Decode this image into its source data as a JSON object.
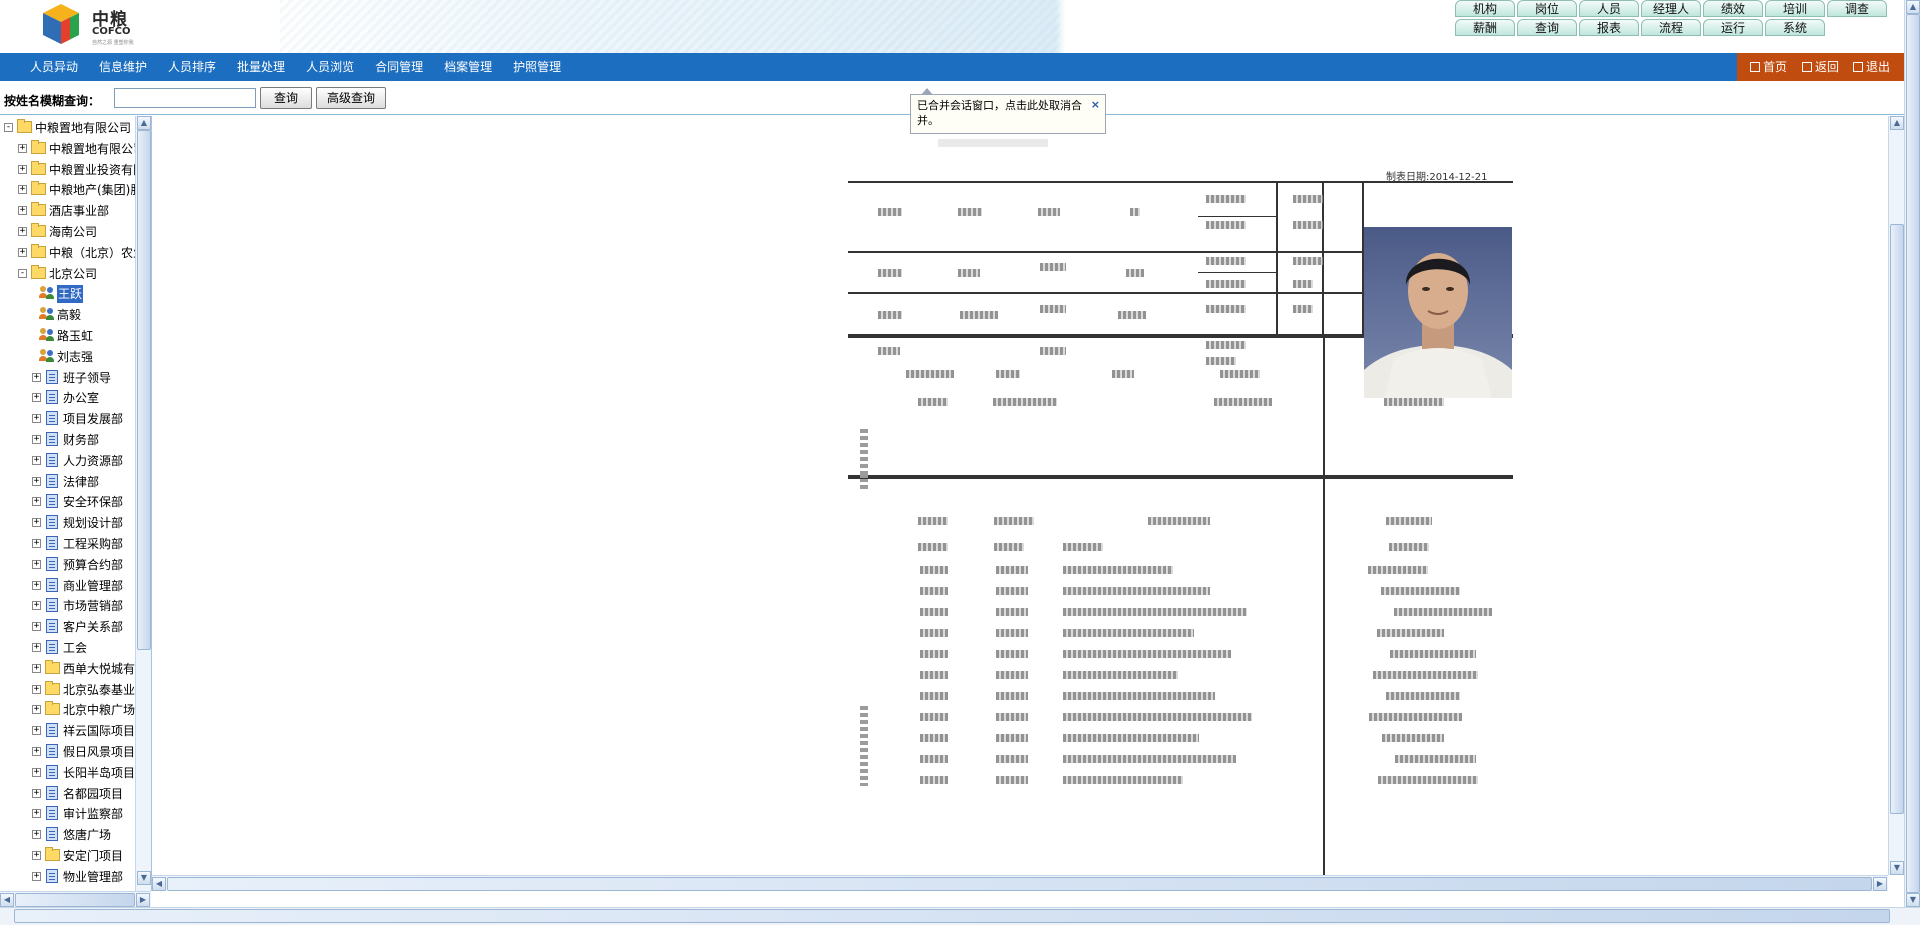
{
  "header": {
    "logo": {
      "brand_cn": "中粮",
      "brand_en": "COFCO",
      "slogan": "自然之源 重塑你我"
    },
    "top_nav_row1": [
      "机构",
      "岗位",
      "人员",
      "经理人",
      "绩效",
      "培训",
      "调查"
    ],
    "top_nav_row2": [
      "薪酬",
      "查询",
      "报表",
      "流程",
      "运行",
      "系统"
    ]
  },
  "navbar": {
    "menu": [
      "人员异动",
      "信息维护",
      "人员排序",
      "批量处理",
      "人员浏览",
      "合同管理",
      "档案管理",
      "护照管理"
    ],
    "home": "首页",
    "back": "返回",
    "logout": "退出"
  },
  "search": {
    "label": "按姓名模糊查询：",
    "input_value": "",
    "query_btn": "查询",
    "advanced_btn": "高级查询"
  },
  "tree": [
    {
      "label": "中粮置地有限公司",
      "level": 0,
      "icon": "folder-icon",
      "toggle": "−"
    },
    {
      "label": "中粮置地有限公司",
      "level": 1,
      "icon": "folder-icon",
      "toggle": "+"
    },
    {
      "label": "中粮置业投资有限",
      "level": 1,
      "icon": "folder-icon",
      "toggle": "+"
    },
    {
      "label": "中粮地产(集团)股",
      "level": 1,
      "icon": "folder-icon",
      "toggle": "+"
    },
    {
      "label": "酒店事业部",
      "level": 1,
      "icon": "folder-icon",
      "toggle": "+"
    },
    {
      "label": "海南公司",
      "level": 1,
      "icon": "folder-icon",
      "toggle": "+"
    },
    {
      "label": "中粮（北京）农业",
      "level": 1,
      "icon": "folder-icon",
      "toggle": "+"
    },
    {
      "label": "北京公司",
      "level": 1,
      "icon": "folder-icon",
      "toggle": "−"
    },
    {
      "label": "王跃",
      "level": 2,
      "icon": "person-icon",
      "toggle": "",
      "selected": true
    },
    {
      "label": "高毅",
      "level": 2,
      "icon": "person-icon",
      "toggle": ""
    },
    {
      "label": "路玉虹",
      "level": 2,
      "icon": "person-icon",
      "toggle": ""
    },
    {
      "label": "刘志强",
      "level": 2,
      "icon": "person-icon",
      "toggle": ""
    },
    {
      "label": "班子领导",
      "level": 2,
      "icon": "document-icon",
      "toggle": "+"
    },
    {
      "label": "办公室",
      "level": 2,
      "icon": "document-icon",
      "toggle": "+"
    },
    {
      "label": "项目发展部",
      "level": 2,
      "icon": "document-icon",
      "toggle": "+"
    },
    {
      "label": "财务部",
      "level": 2,
      "icon": "document-icon",
      "toggle": "+"
    },
    {
      "label": "人力资源部",
      "level": 2,
      "icon": "document-icon",
      "toggle": "+"
    },
    {
      "label": "法律部",
      "level": 2,
      "icon": "document-icon",
      "toggle": "+"
    },
    {
      "label": "安全环保部",
      "level": 2,
      "icon": "document-icon",
      "toggle": "+"
    },
    {
      "label": "规划设计部",
      "level": 2,
      "icon": "document-icon",
      "toggle": "+"
    },
    {
      "label": "工程采购部",
      "level": 2,
      "icon": "document-icon",
      "toggle": "+"
    },
    {
      "label": "预算合约部",
      "level": 2,
      "icon": "document-icon",
      "toggle": "+"
    },
    {
      "label": "商业管理部",
      "level": 2,
      "icon": "document-icon",
      "toggle": "+"
    },
    {
      "label": "市场营销部",
      "level": 2,
      "icon": "document-icon",
      "toggle": "+"
    },
    {
      "label": "客户关系部",
      "level": 2,
      "icon": "document-icon",
      "toggle": "+"
    },
    {
      "label": "工会",
      "level": 2,
      "icon": "document-icon",
      "toggle": "+"
    },
    {
      "label": "西单大悦城有限",
      "level": 2,
      "icon": "folder-icon",
      "toggle": "+"
    },
    {
      "label": "北京弘泰基业房",
      "level": 2,
      "icon": "folder-icon",
      "toggle": "+"
    },
    {
      "label": "北京中粮广场发",
      "level": 2,
      "icon": "folder-icon",
      "toggle": "+"
    },
    {
      "label": "祥云国际项目",
      "level": 2,
      "icon": "document-icon",
      "toggle": "+"
    },
    {
      "label": "假日风景项目",
      "level": 2,
      "icon": "document-icon",
      "toggle": "+"
    },
    {
      "label": "长阳半岛项目",
      "level": 2,
      "icon": "document-icon",
      "toggle": "+"
    },
    {
      "label": "名都园项目",
      "level": 2,
      "icon": "document-icon",
      "toggle": "+"
    },
    {
      "label": "审计监察部",
      "level": 2,
      "icon": "document-icon",
      "toggle": "+"
    },
    {
      "label": "悠唐广场",
      "level": 2,
      "icon": "document-icon",
      "toggle": "+"
    },
    {
      "label": "安定门项目",
      "level": 2,
      "icon": "folder-icon",
      "toggle": "+"
    },
    {
      "label": "物业管理部",
      "level": 2,
      "icon": "document-icon",
      "toggle": "+"
    }
  ],
  "content": {
    "tooltip": "已合并会话窗口，点击此处取消合并。",
    "tooltip_close": "×",
    "report_date": "制表日期:2014-12-21"
  },
  "colors": {
    "navbar": "#1c6ec0",
    "navbar_right": "#c14c10",
    "selected": "#316ac5"
  }
}
